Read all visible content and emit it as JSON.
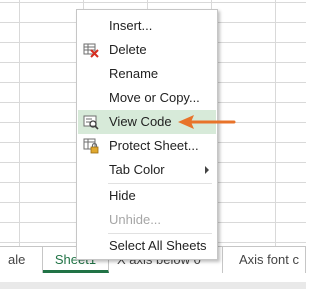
{
  "sheet_tabs": [
    {
      "label": "ale"
    },
    {
      "label": "Sheet1"
    },
    {
      "label": "X axis below 0"
    },
    {
      "label": "Axis font c"
    }
  ],
  "context_menu": {
    "items": [
      {
        "label": "Insert...",
        "icon": null,
        "disabled": false
      },
      {
        "label": "Delete",
        "icon": "delete-sheet-icon",
        "disabled": false
      },
      {
        "label": "Rename",
        "icon": null,
        "disabled": false
      },
      {
        "label": "Move or Copy...",
        "icon": null,
        "disabled": false
      },
      {
        "label": "View Code",
        "icon": "view-code-icon",
        "disabled": false,
        "highlighted": true
      },
      {
        "label": "Protect Sheet...",
        "icon": "protect-sheet-icon",
        "disabled": false
      },
      {
        "label": "Tab Color",
        "icon": null,
        "disabled": false,
        "submenu": true
      },
      {
        "label": "Hide",
        "icon": null,
        "disabled": false
      },
      {
        "label": "Unhide...",
        "icon": null,
        "disabled": true
      },
      {
        "label": "Select All Sheets",
        "icon": null,
        "disabled": false
      }
    ]
  },
  "colors": {
    "highlight": "#d7ead9",
    "active_tab": "#217346",
    "callout_arrow": "#e8732a"
  }
}
